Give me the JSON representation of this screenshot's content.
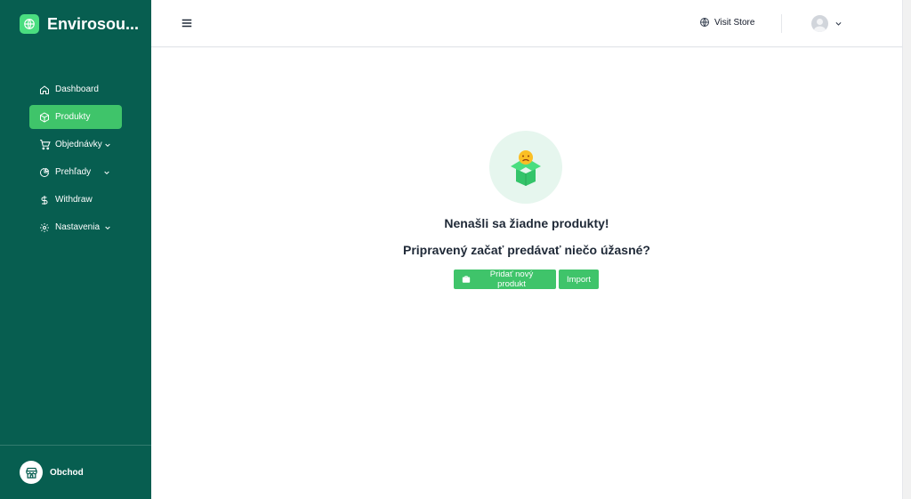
{
  "brand": {
    "name": "Envirosou...",
    "icon": "globe-icon"
  },
  "sidebar": {
    "items": [
      {
        "label": "Dashboard",
        "icon": "home-icon",
        "active": false,
        "has_submenu": false
      },
      {
        "label": "Produkty",
        "icon": "cube-icon",
        "active": true,
        "has_submenu": false
      },
      {
        "label": "Objednávky",
        "icon": "cart-icon",
        "active": false,
        "has_submenu": true
      },
      {
        "label": "Prehľady",
        "icon": "pie-chart-icon",
        "active": false,
        "has_submenu": true
      },
      {
        "label": "Withdraw",
        "icon": "dollar-icon",
        "active": false,
        "has_submenu": false
      },
      {
        "label": "Nastavenia",
        "icon": "gear-icon",
        "active": false,
        "has_submenu": true
      }
    ],
    "store": {
      "name": "Obchod",
      "icon": "storefront-icon"
    }
  },
  "topbar": {
    "menu_icon": "hamburger-icon",
    "visit_store": "Visit Store",
    "visit_store_icon": "globe-icon",
    "user_icon": "avatar"
  },
  "empty_state": {
    "illustration": "sad-box-icon",
    "title": "Nenašli sa žiadne produkty!",
    "subtitle": "Pripravený začať predávať niečo úžasné?",
    "add_button": "Pridať nový produkt",
    "add_button_icon": "briefcase-icon",
    "import_button": "Import"
  },
  "colors": {
    "sidebar_bg": "#075e50",
    "accent": "#3fc46a",
    "illustration_bg": "#e6f6ee"
  }
}
